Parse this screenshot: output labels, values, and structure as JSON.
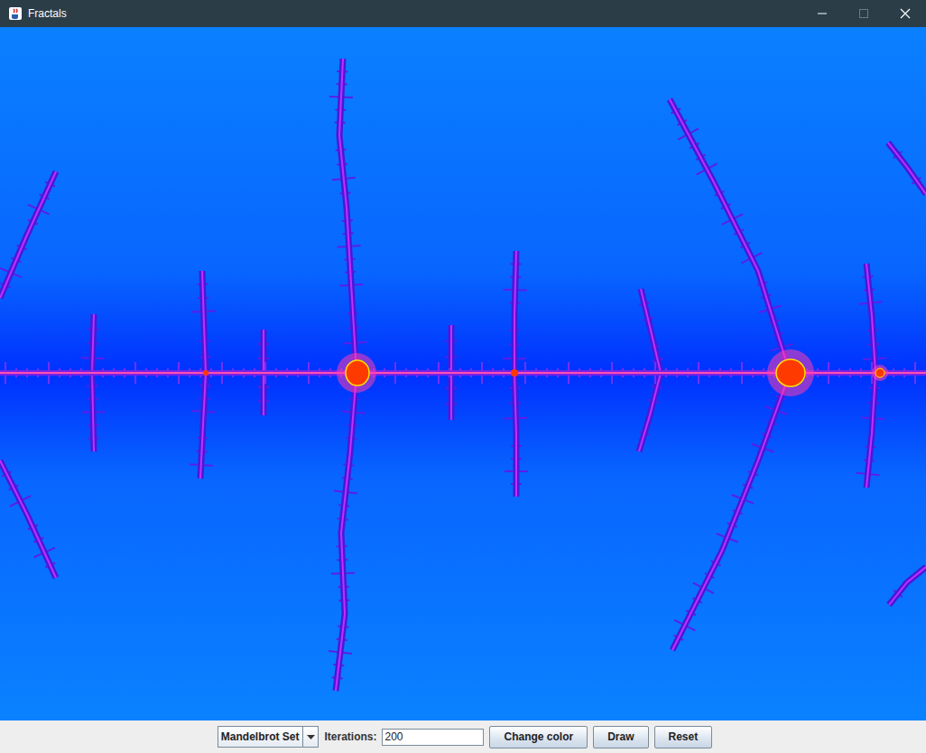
{
  "window": {
    "title": "Fractals",
    "controls": [
      {
        "kind": "minimize",
        "disabled": false
      },
      {
        "kind": "maximize",
        "disabled": true
      },
      {
        "kind": "close",
        "disabled": false
      }
    ]
  },
  "toolbar": {
    "fractal_select": {
      "value": "Mandelbrot Set"
    },
    "iterations": {
      "label": "Iterations:",
      "value": "200"
    },
    "buttons": [
      "Change color",
      "Draw",
      "Reset"
    ]
  }
}
